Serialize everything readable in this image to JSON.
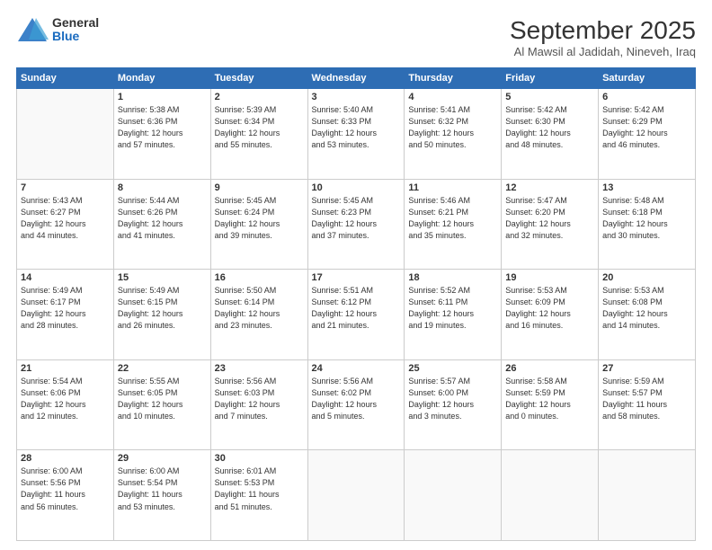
{
  "logo": {
    "line1": "General",
    "line2": "Blue"
  },
  "header": {
    "month": "September 2025",
    "location": "Al Mawsil al Jadidah, Nineveh, Iraq"
  },
  "weekdays": [
    "Sunday",
    "Monday",
    "Tuesday",
    "Wednesday",
    "Thursday",
    "Friday",
    "Saturday"
  ],
  "weeks": [
    [
      {
        "day": "",
        "info": ""
      },
      {
        "day": "1",
        "info": "Sunrise: 5:38 AM\nSunset: 6:36 PM\nDaylight: 12 hours\nand 57 minutes."
      },
      {
        "day": "2",
        "info": "Sunrise: 5:39 AM\nSunset: 6:34 PM\nDaylight: 12 hours\nand 55 minutes."
      },
      {
        "day": "3",
        "info": "Sunrise: 5:40 AM\nSunset: 6:33 PM\nDaylight: 12 hours\nand 53 minutes."
      },
      {
        "day": "4",
        "info": "Sunrise: 5:41 AM\nSunset: 6:32 PM\nDaylight: 12 hours\nand 50 minutes."
      },
      {
        "day": "5",
        "info": "Sunrise: 5:42 AM\nSunset: 6:30 PM\nDaylight: 12 hours\nand 48 minutes."
      },
      {
        "day": "6",
        "info": "Sunrise: 5:42 AM\nSunset: 6:29 PM\nDaylight: 12 hours\nand 46 minutes."
      }
    ],
    [
      {
        "day": "7",
        "info": "Sunrise: 5:43 AM\nSunset: 6:27 PM\nDaylight: 12 hours\nand 44 minutes."
      },
      {
        "day": "8",
        "info": "Sunrise: 5:44 AM\nSunset: 6:26 PM\nDaylight: 12 hours\nand 41 minutes."
      },
      {
        "day": "9",
        "info": "Sunrise: 5:45 AM\nSunset: 6:24 PM\nDaylight: 12 hours\nand 39 minutes."
      },
      {
        "day": "10",
        "info": "Sunrise: 5:45 AM\nSunset: 6:23 PM\nDaylight: 12 hours\nand 37 minutes."
      },
      {
        "day": "11",
        "info": "Sunrise: 5:46 AM\nSunset: 6:21 PM\nDaylight: 12 hours\nand 35 minutes."
      },
      {
        "day": "12",
        "info": "Sunrise: 5:47 AM\nSunset: 6:20 PM\nDaylight: 12 hours\nand 32 minutes."
      },
      {
        "day": "13",
        "info": "Sunrise: 5:48 AM\nSunset: 6:18 PM\nDaylight: 12 hours\nand 30 minutes."
      }
    ],
    [
      {
        "day": "14",
        "info": "Sunrise: 5:49 AM\nSunset: 6:17 PM\nDaylight: 12 hours\nand 28 minutes."
      },
      {
        "day": "15",
        "info": "Sunrise: 5:49 AM\nSunset: 6:15 PM\nDaylight: 12 hours\nand 26 minutes."
      },
      {
        "day": "16",
        "info": "Sunrise: 5:50 AM\nSunset: 6:14 PM\nDaylight: 12 hours\nand 23 minutes."
      },
      {
        "day": "17",
        "info": "Sunrise: 5:51 AM\nSunset: 6:12 PM\nDaylight: 12 hours\nand 21 minutes."
      },
      {
        "day": "18",
        "info": "Sunrise: 5:52 AM\nSunset: 6:11 PM\nDaylight: 12 hours\nand 19 minutes."
      },
      {
        "day": "19",
        "info": "Sunrise: 5:53 AM\nSunset: 6:09 PM\nDaylight: 12 hours\nand 16 minutes."
      },
      {
        "day": "20",
        "info": "Sunrise: 5:53 AM\nSunset: 6:08 PM\nDaylight: 12 hours\nand 14 minutes."
      }
    ],
    [
      {
        "day": "21",
        "info": "Sunrise: 5:54 AM\nSunset: 6:06 PM\nDaylight: 12 hours\nand 12 minutes."
      },
      {
        "day": "22",
        "info": "Sunrise: 5:55 AM\nSunset: 6:05 PM\nDaylight: 12 hours\nand 10 minutes."
      },
      {
        "day": "23",
        "info": "Sunrise: 5:56 AM\nSunset: 6:03 PM\nDaylight: 12 hours\nand 7 minutes."
      },
      {
        "day": "24",
        "info": "Sunrise: 5:56 AM\nSunset: 6:02 PM\nDaylight: 12 hours\nand 5 minutes."
      },
      {
        "day": "25",
        "info": "Sunrise: 5:57 AM\nSunset: 6:00 PM\nDaylight: 12 hours\nand 3 minutes."
      },
      {
        "day": "26",
        "info": "Sunrise: 5:58 AM\nSunset: 5:59 PM\nDaylight: 12 hours\nand 0 minutes."
      },
      {
        "day": "27",
        "info": "Sunrise: 5:59 AM\nSunset: 5:57 PM\nDaylight: 11 hours\nand 58 minutes."
      }
    ],
    [
      {
        "day": "28",
        "info": "Sunrise: 6:00 AM\nSunset: 5:56 PM\nDaylight: 11 hours\nand 56 minutes."
      },
      {
        "day": "29",
        "info": "Sunrise: 6:00 AM\nSunset: 5:54 PM\nDaylight: 11 hours\nand 53 minutes."
      },
      {
        "day": "30",
        "info": "Sunrise: 6:01 AM\nSunset: 5:53 PM\nDaylight: 11 hours\nand 51 minutes."
      },
      {
        "day": "",
        "info": ""
      },
      {
        "day": "",
        "info": ""
      },
      {
        "day": "",
        "info": ""
      },
      {
        "day": "",
        "info": ""
      }
    ]
  ]
}
